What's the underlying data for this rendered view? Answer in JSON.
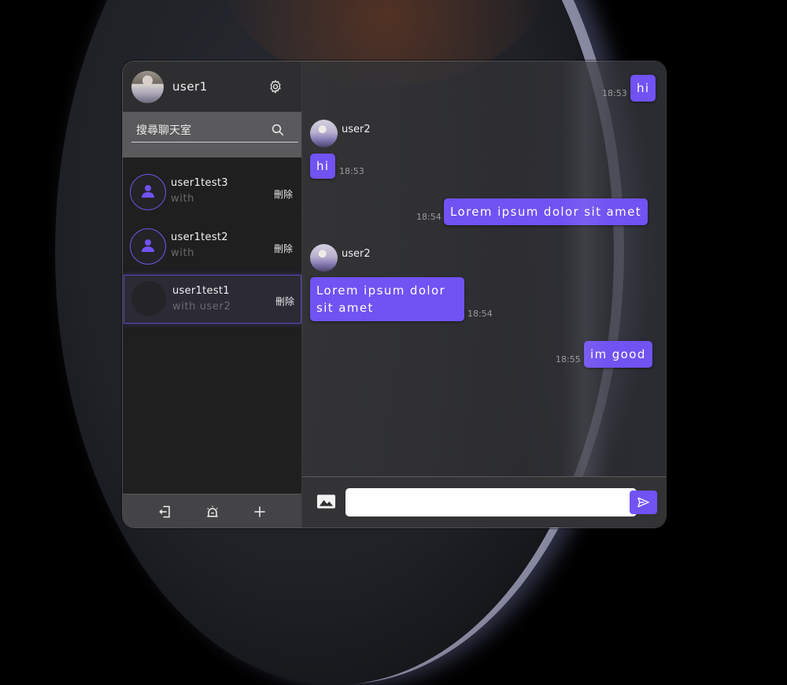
{
  "user": {
    "name": "user1"
  },
  "search": {
    "placeholder": "搜尋聊天室"
  },
  "rooms": [
    {
      "name": "user1test3",
      "sub": "with",
      "delete_label": "刪除"
    },
    {
      "name": "user1test2",
      "sub": "with",
      "delete_label": "刪除"
    },
    {
      "name": "user1test1",
      "sub": "with user2",
      "delete_label": "刪除"
    }
  ],
  "messages": [
    {
      "text": "hi",
      "time": "18:53",
      "sender": ""
    },
    {
      "text": "hi",
      "time": "18:53",
      "sender": "user2"
    },
    {
      "text": "Lorem ipsum dolor sit amet",
      "time": "18:54",
      "sender": ""
    },
    {
      "text": "Lorem ipsum dolor sit amet",
      "time": "18:54",
      "sender": "user2"
    },
    {
      "text": "im good",
      "time": "18:55",
      "sender": ""
    }
  ],
  "composer": {
    "value": ""
  },
  "icons": {
    "settings": "gear-icon",
    "search": "search-icon",
    "logout": "logout-icon",
    "alarm": "alarm-icon",
    "add": "plus-icon",
    "image": "image-icon",
    "send": "send-icon"
  },
  "colors": {
    "accent": "#7152f3",
    "sidebar": "#1f1f20",
    "chat_bg": "#343436"
  }
}
